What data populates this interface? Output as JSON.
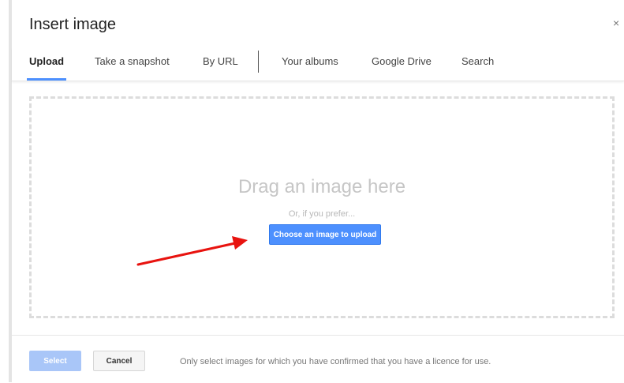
{
  "dialog": {
    "title": "Insert image",
    "close_icon": "close-icon",
    "close_glyph": "×"
  },
  "tabs": [
    {
      "label": "Upload",
      "active": true
    },
    {
      "label": "Take a snapshot"
    },
    {
      "label": "By URL"
    },
    {
      "label": "Your albums"
    },
    {
      "label": "Google Drive"
    },
    {
      "label": "Search"
    }
  ],
  "dropzone": {
    "heading": "Drag an image here",
    "subtext": "Or, if you prefer...",
    "upload_button": "Choose an image to upload"
  },
  "footer": {
    "select_label": "Select",
    "cancel_label": "Cancel",
    "note": "Only select images for which you have confirmed that you have a licence for use."
  },
  "colors": {
    "accent": "#4d90fe",
    "annotation_arrow": "#e8130f"
  }
}
